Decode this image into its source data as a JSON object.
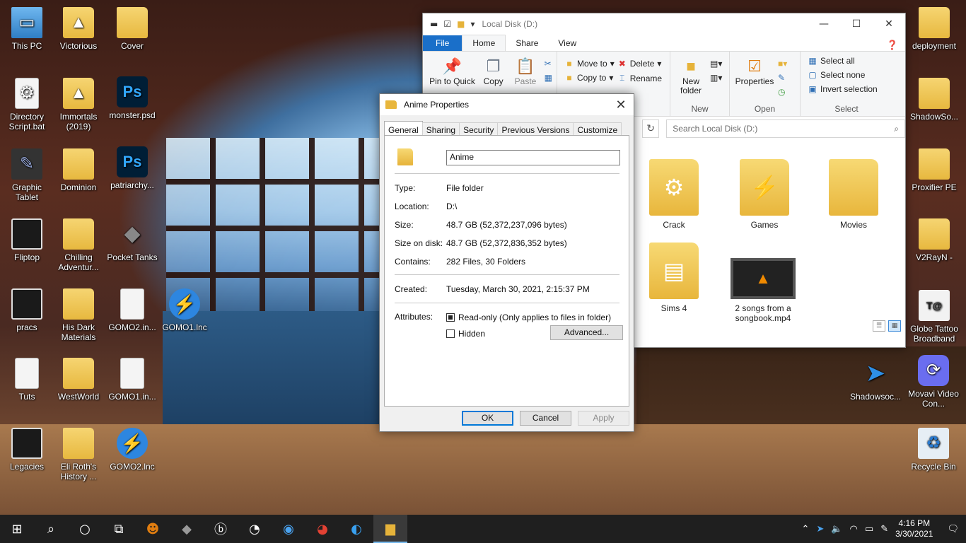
{
  "desktop": {
    "icons": [
      {
        "label": "This PC",
        "icon": "pc-icon"
      },
      {
        "label": "Victorious",
        "icon": "vlc-folder-icon"
      },
      {
        "label": "Cover",
        "icon": "folder-icon"
      },
      {
        "label": "Directory Script.bat",
        "icon": "batch-file-icon"
      },
      {
        "label": "Immortals (2019)",
        "icon": "vlc-folder-icon"
      },
      {
        "label": "monster.psd",
        "icon": "photoshop-icon"
      },
      {
        "label": "Graphic Tablet",
        "icon": "tablet-icon"
      },
      {
        "label": "Dominion",
        "icon": "folder-icon"
      },
      {
        "label": "patriarchy...",
        "icon": "photoshop-icon"
      },
      {
        "label": "Fliptop",
        "icon": "folder-icon"
      },
      {
        "label": "Chilling Adventur...",
        "icon": "folder-icon"
      },
      {
        "label": "Pocket Tanks",
        "icon": "tank-icon"
      },
      {
        "label": "pracs",
        "icon": "folder-icon"
      },
      {
        "label": "His Dark Materials",
        "icon": "folder-icon"
      },
      {
        "label": "GOMO2.in...",
        "icon": "file-icon"
      },
      {
        "label": "GOMO1.lnc",
        "icon": "app-bolt-icon"
      },
      {
        "label": "Tuts",
        "icon": "folder-icon"
      },
      {
        "label": "WestWorld",
        "icon": "folder-icon"
      },
      {
        "label": "GOMO1.in...",
        "icon": "file-icon"
      },
      {
        "label": "Legacies",
        "icon": "folder-icon"
      },
      {
        "label": "Eli Roth's History ...",
        "icon": "folder-icon"
      },
      {
        "label": "GOMO2.lnc",
        "icon": "app-bolt-icon"
      },
      {
        "label": "deployment",
        "icon": "folder-icon"
      },
      {
        "label": "ShadowSo...",
        "icon": "folder-icon"
      },
      {
        "label": "Proxifier PE",
        "icon": "folder-icon"
      },
      {
        "label": "V2RayN -",
        "icon": "folder-icon"
      },
      {
        "label": "Globe Tattoo Broadband",
        "icon": "tattoo-icon"
      },
      {
        "label": "Shadowsoc...",
        "icon": "paper-plane-icon"
      },
      {
        "label": "Movavi Video Con...",
        "icon": "movavi-icon"
      },
      {
        "label": "Recycle Bin",
        "icon": "recycle-bin-icon"
      }
    ]
  },
  "explorer": {
    "title": "Local Disk (D:)",
    "tabs": {
      "file": "File",
      "home": "Home",
      "share": "Share",
      "view": "View"
    },
    "ribbon": {
      "pin_to_quick": "Pin to Quick",
      "copy": "Copy",
      "paste": "Paste",
      "move_to": "Move to",
      "copy_to": "Copy to",
      "delete": "Delete",
      "rename": "Rename",
      "new_folder": "New folder",
      "new_group": "New",
      "properties": "Properties",
      "open_group": "Open",
      "select_all": "Select all",
      "select_none": "Select none",
      "invert_selection": "Invert selection",
      "select_group": "Select"
    },
    "search_placeholder": "Search Local Disk (D:)",
    "items": [
      {
        "label": "Crack"
      },
      {
        "label": "Games"
      },
      {
        "label": "Movies"
      },
      {
        "label": "Sims 4"
      },
      {
        "label": "2 songs from a songbook.mp4"
      }
    ]
  },
  "dialog": {
    "title": "Anime Properties",
    "tabs": [
      "General",
      "Sharing",
      "Security",
      "Previous Versions",
      "Customize"
    ],
    "name_value": "Anime",
    "rows": {
      "type_k": "Type:",
      "type_v": "File folder",
      "location_k": "Location:",
      "location_v": "D:\\",
      "size_k": "Size:",
      "size_v": "48.7 GB (52,372,237,096 bytes)",
      "sod_k": "Size on disk:",
      "sod_v": "48.7 GB (52,372,836,352 bytes)",
      "contains_k": "Contains:",
      "contains_v": "282 Files, 30 Folders",
      "created_k": "Created:",
      "created_v": "Tuesday, March 30, 2021, 2:15:37 PM",
      "attributes_k": "Attributes:"
    },
    "readonly_label": "Read-only (Only applies to files in folder)",
    "hidden_label": "Hidden",
    "advanced_label": "Advanced...",
    "ok_label": "OK",
    "cancel_label": "Cancel",
    "apply_label": "Apply"
  },
  "taskbar": {
    "time": "4:16 PM",
    "date": "3/30/2021"
  }
}
